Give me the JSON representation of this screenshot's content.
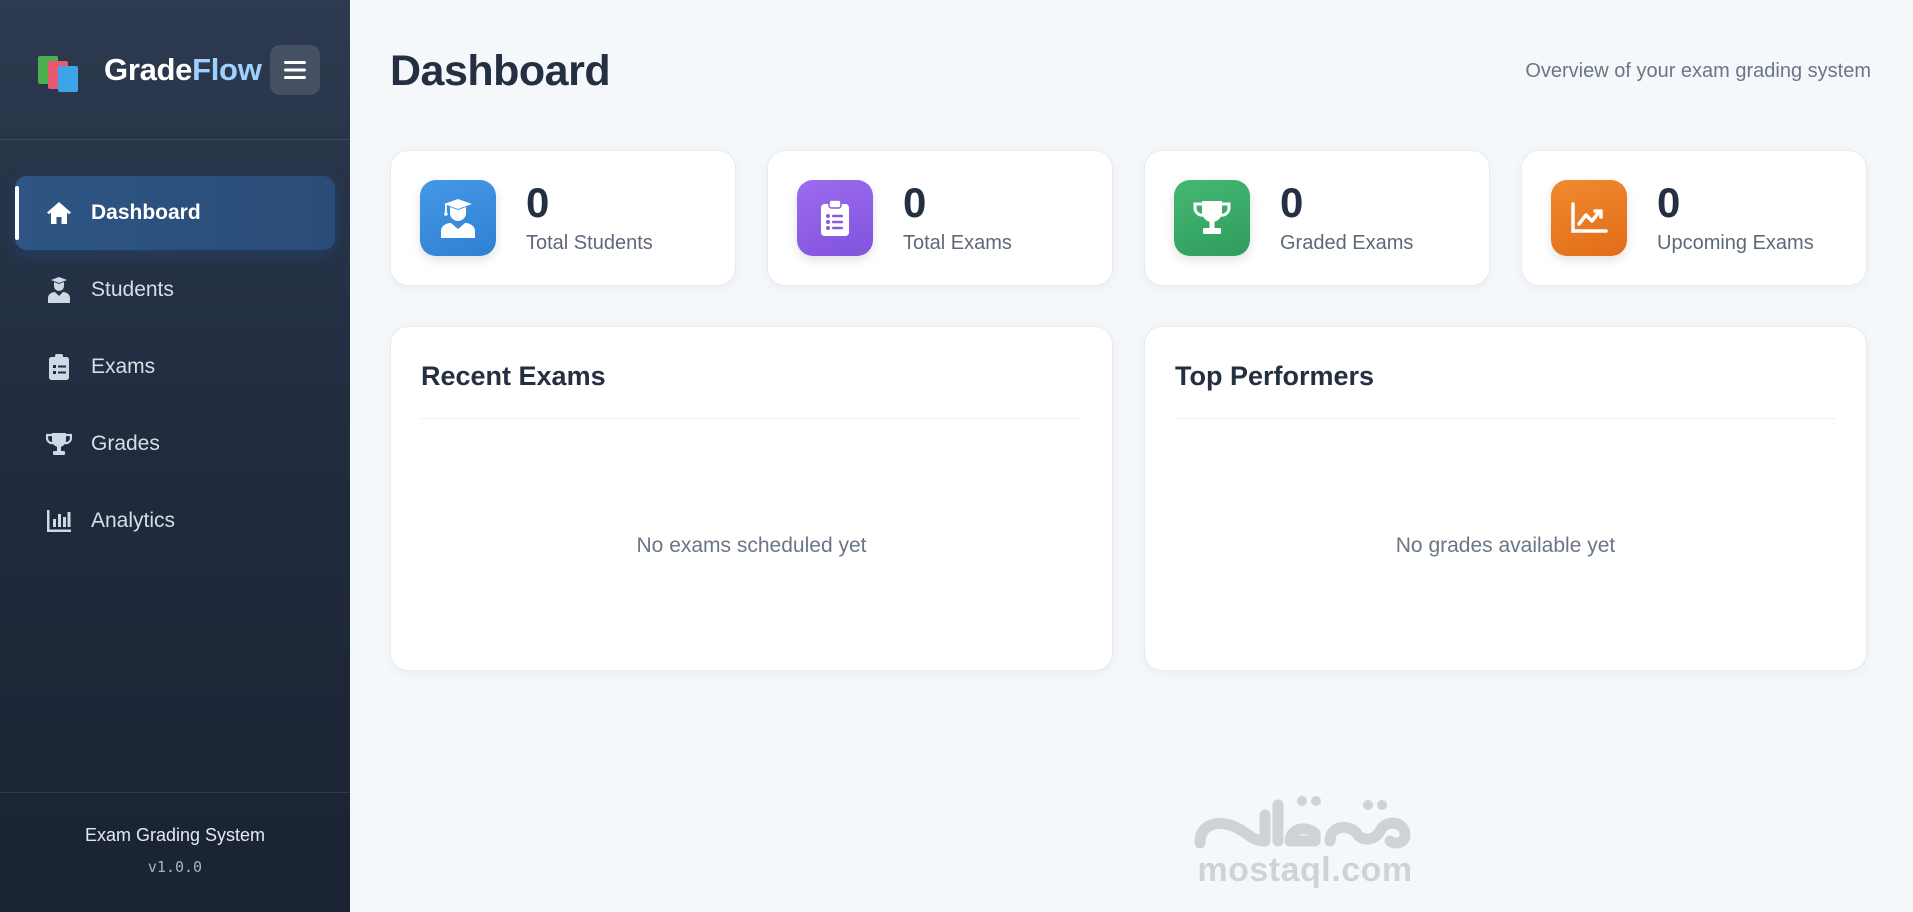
{
  "brand": {
    "name_part1": "Grade",
    "name_part2": "Flow"
  },
  "sidebar": {
    "items": [
      {
        "label": "Dashboard",
        "icon": "home-icon",
        "active": true
      },
      {
        "label": "Students",
        "icon": "student-icon",
        "active": false
      },
      {
        "label": "Exams",
        "icon": "clipboard-icon",
        "active": false
      },
      {
        "label": "Grades",
        "icon": "trophy-icon",
        "active": false
      },
      {
        "label": "Analytics",
        "icon": "bar-chart-icon",
        "active": false
      }
    ],
    "footer": {
      "title": "Exam Grading System",
      "version": "v1.0.0"
    }
  },
  "header": {
    "title": "Dashboard",
    "subtitle": "Overview of your exam grading system"
  },
  "stats": [
    {
      "value": "0",
      "label": "Total Students",
      "icon": "graduate-icon",
      "color": "#3a8ee0"
    },
    {
      "value": "0",
      "label": "Total Exams",
      "icon": "clipboard-list-icon",
      "color": "#9061e6"
    },
    {
      "value": "0",
      "label": "Graded Exams",
      "icon": "trophy-icon",
      "color": "#39ac68"
    },
    {
      "value": "0",
      "label": "Upcoming Exams",
      "icon": "trend-chart-icon",
      "color": "#ec7a22"
    }
  ],
  "panels": {
    "recent_exams": {
      "title": "Recent Exams",
      "empty_text": "No exams scheduled yet"
    },
    "top_performers": {
      "title": "Top Performers",
      "empty_text": "No grades available yet"
    }
  },
  "watermark": {
    "text": "mostaql.com"
  }
}
